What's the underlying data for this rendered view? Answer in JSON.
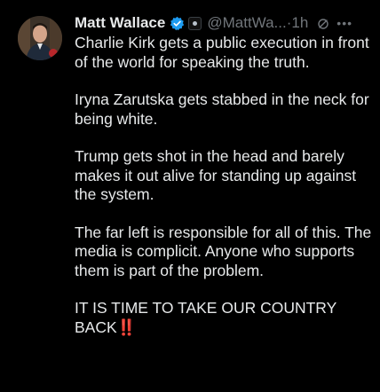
{
  "author": {
    "name": "Matt Wallace",
    "handle": "@MattWa...",
    "separator": "·",
    "time": "1h",
    "verified_color": "#1d9bf0"
  },
  "icons": {
    "avatar": "profile-photo",
    "verified": "verified-badge-icon",
    "affiliate": "affiliate-badge-icon",
    "grok": "grok-icon",
    "more": "more-options-icon"
  },
  "paragraphs": [
    "Charlie Kirk gets a public execution in front of the world for speaking the truth.",
    "Iryna Zarutska gets stabbed in the neck for being white.",
    "Trump gets shot in the head and barely makes it out alive for standing up against the system.",
    "The far left is responsible for all of this. The media is complicit. Anyone who supports them is part of the problem."
  ],
  "final_line": {
    "text": "IT IS TIME TO TAKE OUR COUNTRY BACK",
    "emoji": "‼️"
  },
  "colors": {
    "background": "#000000",
    "text": "#e7e9ea",
    "secondary": "#71767b",
    "emoji_red": "#e0191f"
  }
}
